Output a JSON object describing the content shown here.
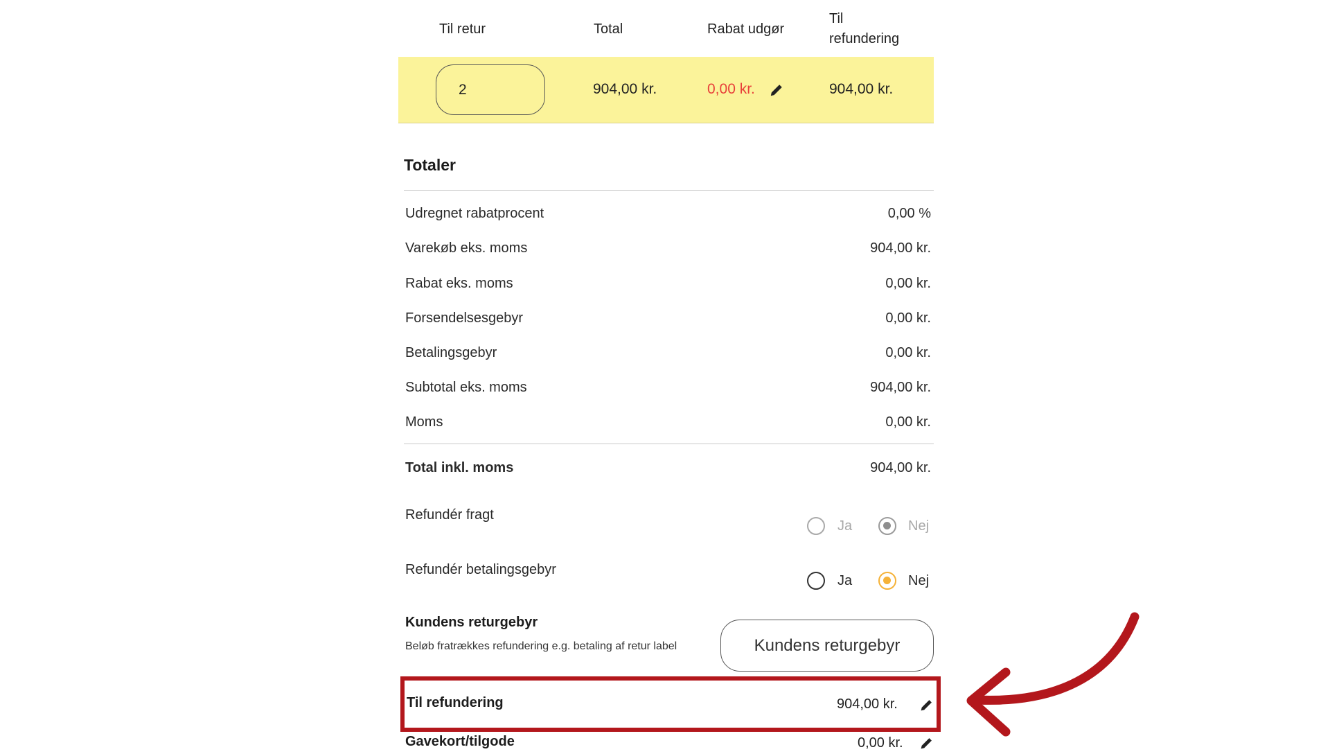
{
  "table": {
    "headers": {
      "til_retur": "Til retur",
      "total": "Total",
      "rabat_udgor": "Rabat udgør",
      "til_refundering_line1": "Til",
      "til_refundering_line2": "refundering"
    },
    "row": {
      "quantity": "2",
      "total": "904,00 kr.",
      "rabat": "0,00 kr.",
      "til_refundering": "904,00 kr."
    }
  },
  "totals": {
    "title": "Totaler",
    "rows": [
      {
        "label": "Udregnet rabatprocent",
        "value": "0,00 %"
      },
      {
        "label": "Varekøb eks. moms",
        "value": "904,00 kr."
      },
      {
        "label": "Rabat eks. moms",
        "value": "0,00 kr."
      },
      {
        "label": "Forsendelsesgebyr",
        "value": "0,00 kr."
      },
      {
        "label": "Betalingsgebyr",
        "value": "0,00 kr."
      },
      {
        "label": "Subtotal eks. moms",
        "value": "904,00 kr."
      },
      {
        "label": "Moms",
        "value": "0,00 kr."
      }
    ],
    "grand_total": {
      "label": "Total inkl. moms",
      "value": "904,00 kr."
    }
  },
  "refund_options": {
    "fragt": {
      "label": "Refundér fragt",
      "yes": "Ja",
      "no": "Nej",
      "selected": "Nej",
      "disabled": true
    },
    "betalingsgebyr": {
      "label": "Refundér betalingsgebyr",
      "yes": "Ja",
      "no": "Nej",
      "selected": "Nej",
      "disabled": false
    }
  },
  "customer_fee": {
    "title": "Kundens returgebyr",
    "help": "Beløb fratrækkes refundering e.g. betaling af retur label",
    "button_label": "Kundens returgebyr"
  },
  "refund": {
    "label": "Til refundering",
    "value": "904,00 kr."
  },
  "giftcard": {
    "label": "Gavekort/tilgode",
    "value": "0,00 kr."
  },
  "colors": {
    "row_highlight": "#fbf39a",
    "discount_red": "#e8403a",
    "radio_selected": "#f5b238",
    "annotation_red": "#b3171c"
  },
  "icons": [
    "pencil-icon",
    "annotation-arrow-icon"
  ]
}
